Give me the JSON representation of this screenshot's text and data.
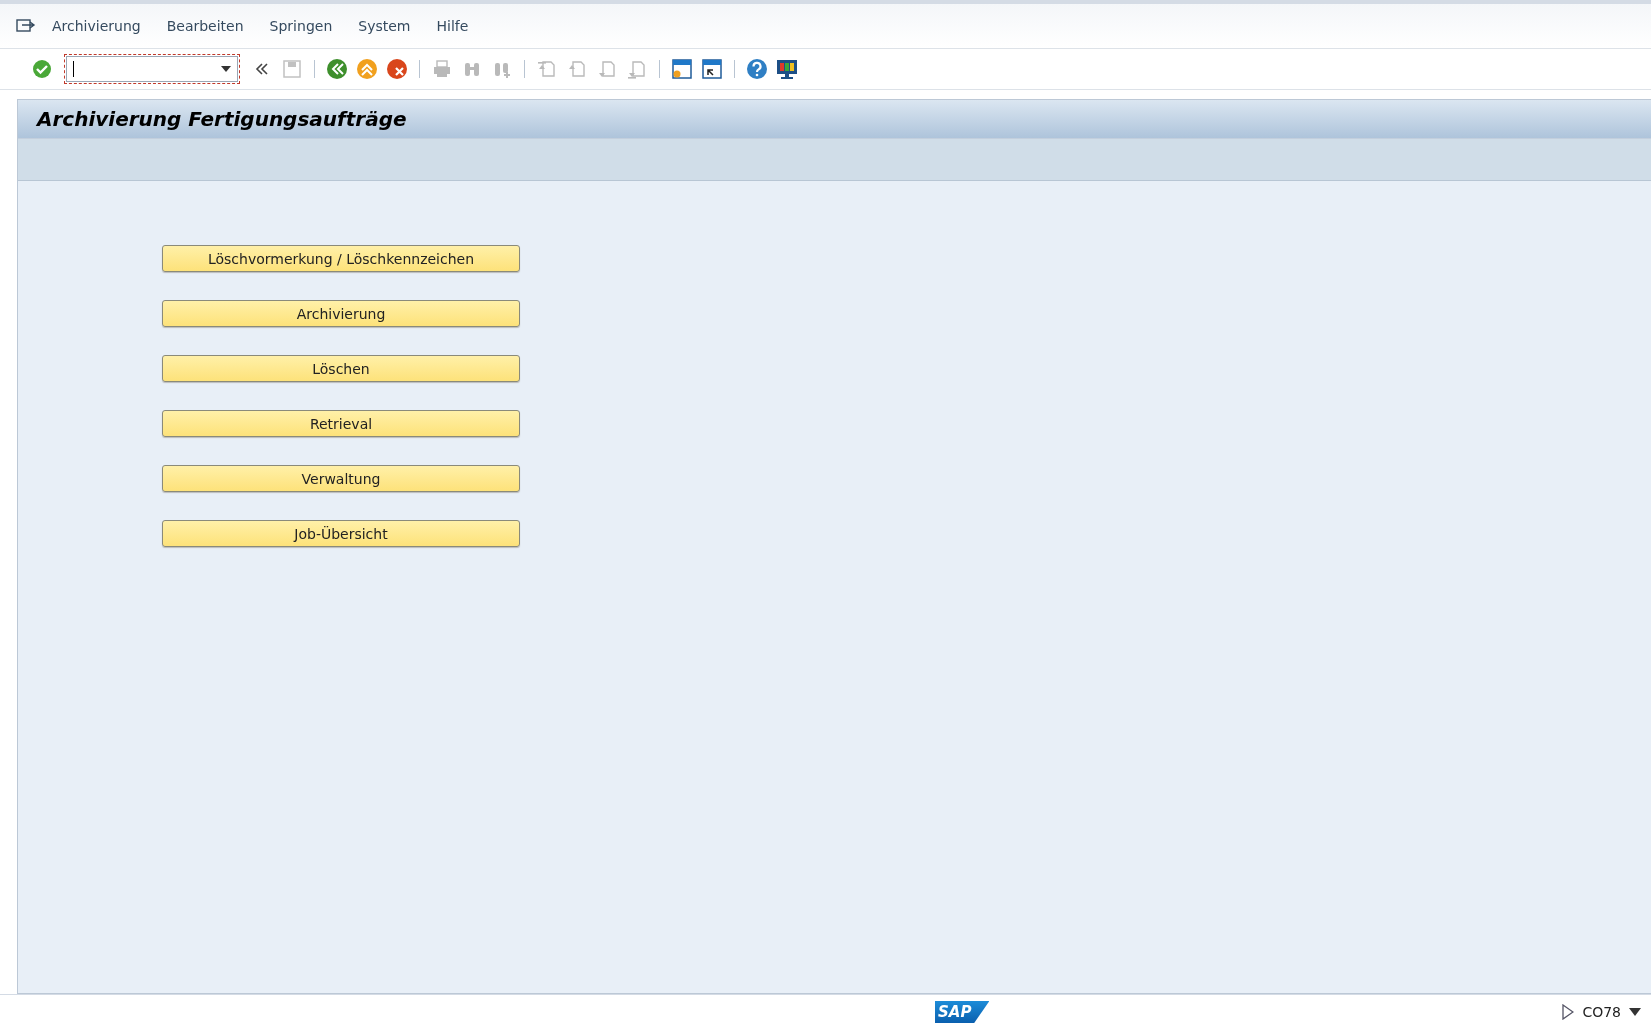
{
  "menu": [
    {
      "label": "Archivierung"
    },
    {
      "label": "Bearbeiten"
    },
    {
      "label": "Springen"
    },
    {
      "label": "System"
    },
    {
      "label": "Hilfe"
    }
  ],
  "toolbar": [
    {
      "kind": "enter",
      "disabled": false
    },
    {
      "kind": "field"
    },
    {
      "kind": "collapse",
      "disabled": false
    },
    {
      "kind": "save",
      "disabled": true
    },
    {
      "kind": "sep"
    },
    {
      "kind": "back",
      "disabled": false
    },
    {
      "kind": "exit",
      "disabled": false
    },
    {
      "kind": "cancel",
      "disabled": false
    },
    {
      "kind": "sep"
    },
    {
      "kind": "print",
      "disabled": true
    },
    {
      "kind": "find",
      "disabled": true
    },
    {
      "kind": "findnext",
      "disabled": true
    },
    {
      "kind": "sep"
    },
    {
      "kind": "first",
      "disabled": true
    },
    {
      "kind": "prev",
      "disabled": true
    },
    {
      "kind": "next",
      "disabled": true
    },
    {
      "kind": "last",
      "disabled": true
    },
    {
      "kind": "sep"
    },
    {
      "kind": "newsession",
      "disabled": false
    },
    {
      "kind": "shortcut",
      "disabled": false
    },
    {
      "kind": "sep"
    },
    {
      "kind": "help",
      "disabled": false
    },
    {
      "kind": "layout",
      "disabled": false
    }
  ],
  "title": "Archivierung Fertigungsaufträge",
  "buttons": [
    {
      "label": "Löschvormerkung / Löschkennzeichen"
    },
    {
      "label": "Archivierung"
    },
    {
      "label": "Löschen"
    },
    {
      "label": "Retrieval"
    },
    {
      "label": "Verwaltung"
    },
    {
      "label": "Job-Übersicht"
    }
  ],
  "status_bar": {
    "logo": "SAP",
    "transaction": "CO78"
  }
}
